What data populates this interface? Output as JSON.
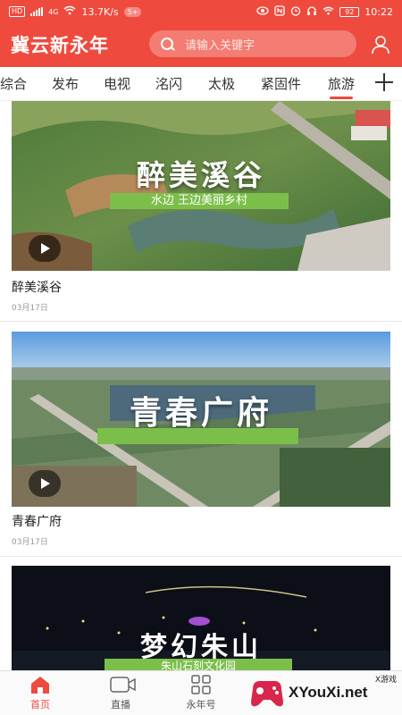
{
  "status_bar": {
    "network_speed": "13.7K/s",
    "hd_badge": "HD",
    "signal_label": "4G",
    "notification_badge": "5+",
    "battery": "92",
    "time": "10:22"
  },
  "header": {
    "app_title": "冀云新永年",
    "search_placeholder": "请输入关键字"
  },
  "tabs": [
    {
      "label": "综合",
      "active": false
    },
    {
      "label": "发布",
      "active": false
    },
    {
      "label": "电视",
      "active": false
    },
    {
      "label": "洺闪",
      "active": false
    },
    {
      "label": "太极",
      "active": false
    },
    {
      "label": "紧固件",
      "active": false
    },
    {
      "label": "旅游",
      "active": true
    }
  ],
  "feed": [
    {
      "title": "醉美溪谷",
      "date": "03月17日",
      "overlay_title": "醉美溪谷",
      "overlay_subtitle": "水边 王边美丽乡村"
    },
    {
      "title": "青春广府",
      "date": "03月17日",
      "overlay_title": "青春广府",
      "overlay_subtitle": ""
    },
    {
      "title": "",
      "date": "",
      "overlay_title": "梦幻朱山",
      "overlay_subtitle": "朱山石刻文化园"
    }
  ],
  "bottom_nav": [
    {
      "label": "首页",
      "icon": "home-icon",
      "active": true
    },
    {
      "label": "直播",
      "icon": "live-camera-icon",
      "active": false
    },
    {
      "label": "永年号",
      "icon": "grid-icon",
      "active": false
    }
  ],
  "watermark": {
    "text": "XYouXi.net",
    "small": "X游戏"
  },
  "colors": {
    "brand_red": "#ef4a3e",
    "overlay_green": "#7bbf4a"
  }
}
